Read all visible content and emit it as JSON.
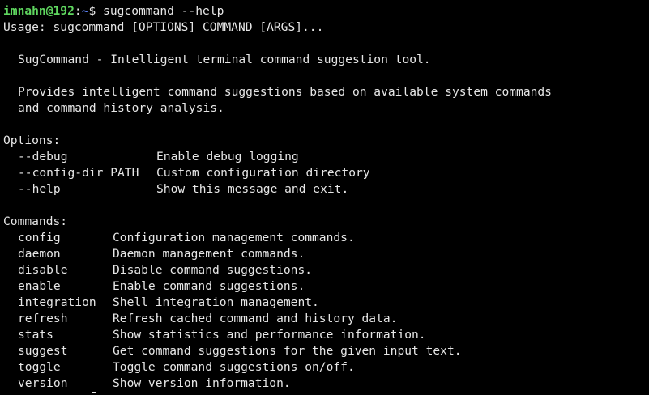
{
  "prompt": {
    "user_host": "imnahn@192",
    "separator": ":",
    "path": "~",
    "symbol": "$",
    "command": " sugcommand --help"
  },
  "usage": "Usage: sugcommand [OPTIONS] COMMAND [ARGS]...",
  "title_line": "SugCommand - Intelligent terminal command suggestion tool.",
  "description": [
    "Provides intelligent command suggestions based on available system commands",
    "and command history analysis."
  ],
  "options_header": "Options:",
  "options": [
    {
      "name": "--debug",
      "desc": "Enable debug logging"
    },
    {
      "name": "--config-dir PATH",
      "desc": "Custom configuration directory"
    },
    {
      "name": "--help",
      "desc": "Show this message and exit."
    }
  ],
  "commands_header": "Commands:",
  "commands": [
    {
      "name": "config",
      "desc": "Configuration management commands."
    },
    {
      "name": "daemon",
      "desc": "Daemon management commands."
    },
    {
      "name": "disable",
      "desc": "Disable command suggestions."
    },
    {
      "name": "enable",
      "desc": "Enable command suggestions."
    },
    {
      "name": "integration",
      "desc": "Shell integration management."
    },
    {
      "name": "refresh",
      "desc": "Refresh cached command and history data."
    },
    {
      "name": "stats",
      "desc": "Show statistics and performance information."
    },
    {
      "name": "suggest",
      "desc": "Get command suggestions for the given input text."
    },
    {
      "name": "toggle",
      "desc": "Toggle command suggestions on/off."
    },
    {
      "name": "version",
      "desc": "Show version information."
    }
  ],
  "colors": {
    "background": "#000000",
    "text": "#e6e6e6",
    "prompt_user": "#5fd75f",
    "prompt_path": "#5f87ff"
  }
}
